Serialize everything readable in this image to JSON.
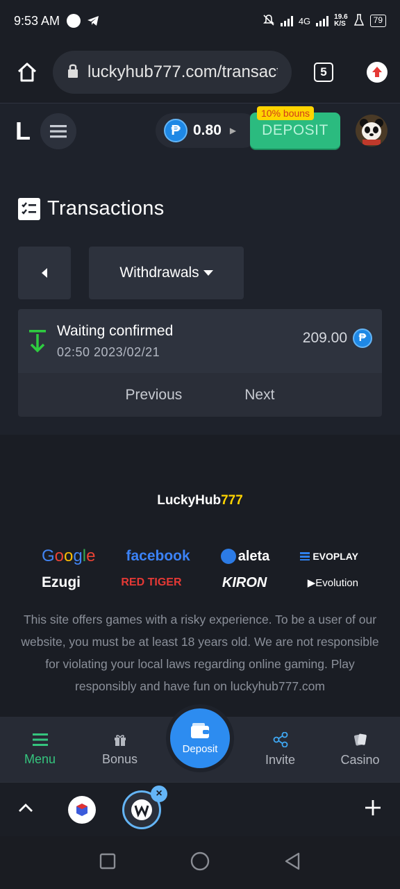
{
  "statusbar": {
    "time": "9:53 AM",
    "network": "4G",
    "speed_value": "19.6",
    "speed_unit": "K/S",
    "battery": "79"
  },
  "browser": {
    "url": "luckyhub777.com/transactions",
    "tab_count": "5"
  },
  "header": {
    "logo": "L",
    "balance": "0.80",
    "currency_symbol": "₱",
    "deposit_label": "DEPOSIT",
    "bonus_tag": "10% bouns"
  },
  "main": {
    "title": "Transactions",
    "filter_label": "Withdrawals",
    "transactions": [
      {
        "status": "Waiting confirmed",
        "datetime": "02:50 2023/02/21",
        "amount": "209.00"
      }
    ],
    "pager": {
      "previous": "Previous",
      "next": "Next"
    }
  },
  "footer": {
    "brand_main": "LuckyHub",
    "brand_highlight": "777",
    "partners": {
      "google": "Google",
      "facebook": "facebook",
      "caleta": "aleta",
      "evoplay": "EVOPLAY",
      "ezugi": "Ezugi",
      "redtiger": "RED TIGER",
      "kiron": "KIRON",
      "evolution": "Evolution"
    },
    "disclaimer": "This site offers games with a risky experience. To be a user of our website, you must be at least 18 years old. We are not responsible for violating your local laws regarding online gaming. Play responsibly and have fun on luckyhub777.com"
  },
  "bottom_nav": {
    "menu": "Menu",
    "bonus": "Bonus",
    "deposit": "Deposit",
    "invite": "Invite",
    "casino": "Casino",
    "active_color": "#35c57e",
    "deposit_color": "#2d8cf0"
  }
}
